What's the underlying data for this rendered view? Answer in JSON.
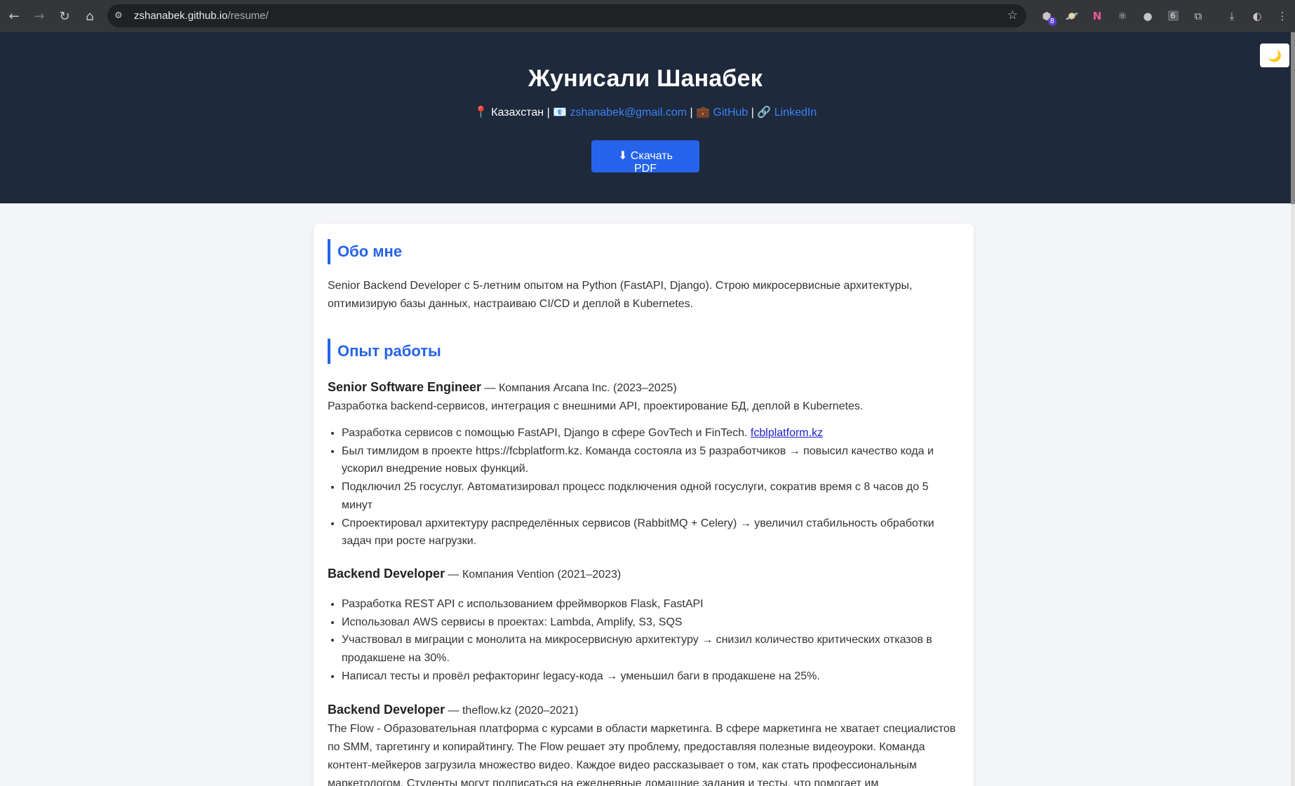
{
  "browser": {
    "url_host": "zshanabek.github.io",
    "url_path": "/resume/",
    "ext_badge_count": "8",
    "ext_tab_count": "6"
  },
  "header": {
    "name": "Жунисали Шанабек",
    "location_icon": "📍",
    "location": "Казахстан",
    "separator": " | ",
    "email_icon": "📧",
    "email": "zshanabek@gmail.com",
    "github_icon": "💼",
    "github": "GitHub",
    "linkedin_icon": "🔗",
    "linkedin": "LinkedIn",
    "download_button": "⬇ Скачать PDF",
    "theme_toggle_icon": "🌙"
  },
  "about": {
    "title": "Обо мне",
    "text": "Senior Backend Developer с 5-летним опытом на Python (FastAPI, Django). Строю микросервисные архитектуры, оптимизирую базы данных, настраиваю CI/CD и деплой в Kubernetes."
  },
  "experience": {
    "title": "Опыт работы",
    "jobs": [
      {
        "role": "Senior Software Engineer",
        "company": " — Компания Arcana Inc. (2023–2025)",
        "description": "Разработка backend-сервисов, интеграция с внешними API, проектирование БД, деплой в Kubernetes.",
        "bullet_1": "Разработка сервисов с помощью FastAPI, Django в сфере GovTech и FinTech. ",
        "bullet_1_link": "fcblplatform.kz",
        "bullet_2": "Был тимлидом в проекте https://fcbplatform.kz. Команда состояла из 5 разработчиков → повысил качество кода и ускорил внедрение новых функций.",
        "bullet_3": "Подключил 25 госуслуг. Автоматизировал процесс подключения одной госуслуги, сократив время с 8 часов до 5 минут",
        "bullet_4": "Спроектировал архитектуру распределённых сервисов (RabbitMQ + Celery) → увеличил стабильность обработки задач при росте нагрузки."
      },
      {
        "role": "Backend Developer",
        "company": " — Компания Vention (2021–2023)",
        "bullet_1": "Разработка REST API с использованием фреймворков Flask, FastAPI",
        "bullet_2": "Использовал AWS сервисы в проектах: Lambda, Amplify, S3, SQS",
        "bullet_3": "Участвовал в миграции с монолита на микросервисную архитектуру → снизил количество критических отказов в продакшене на 30%.",
        "bullet_4": "Написал тесты и провёл рефакторинг legacy-кода → уменьшил баги в продакшене на 25%."
      },
      {
        "role": "Backend Developer",
        "company": " — theflow.kz (2020–2021)",
        "description": "The Flow - Образовательная платформа с курсами в области маркетинга. В сфере маркетинга не хватает специалистов по SMM, таргетингу и копирайтингу. The Flow решает эту проблему, предоставляя полезные видеоуроки. Команда контент-мейкеров загрузила множество видео. Каждое видео рассказывает о том, как стать профессиональным маркетологом. Студенты могут подписаться на ежедневные домашние задания и тесты, что помогает им"
      }
    ]
  }
}
